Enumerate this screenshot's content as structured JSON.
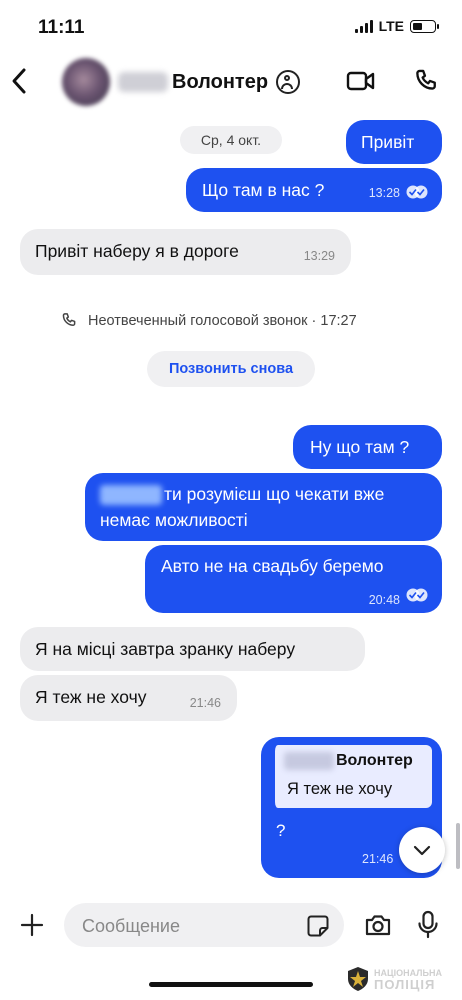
{
  "status_bar": {
    "time": "11:11",
    "network": "LTE"
  },
  "header": {
    "title": "Волонтер"
  },
  "messages": {
    "date_chip": "Ср, 4 окт.",
    "m1": {
      "text": "Привіт"
    },
    "m2": {
      "text": "Що там в нас ?",
      "time": "13:28"
    },
    "m3": {
      "text": "Привіт наберу я в дороге",
      "time": "13:29"
    },
    "missed_call": "Неотвеченный голосовой звонок · 17:27",
    "call_again": "Позвонить снова",
    "m4": {
      "text": "Ну що там ?"
    },
    "m5": {
      "visible_prefix": "ти",
      "line1": "розумієш що чекати вже",
      "line2": "немає можливості"
    },
    "m6": {
      "text": "Авто не на свадьбу беремо",
      "time": "20:48"
    },
    "m7": {
      "text": "Я на місці завтра зранку наберу"
    },
    "m8": {
      "text": "Я теж не хочу",
      "time": "21:46"
    },
    "m9": {
      "quote_name": "Волонтер",
      "quote_text": "Я теж не хочу",
      "text": "?",
      "time": "21:46"
    }
  },
  "composer": {
    "placeholder": "Сообщение"
  },
  "watermark": {
    "line1": "НАЦІОНАЛЬНА",
    "line2": "ПОЛІЦІЯ"
  },
  "colors": {
    "accent": "#1e51f0",
    "incoming": "#ececee"
  }
}
